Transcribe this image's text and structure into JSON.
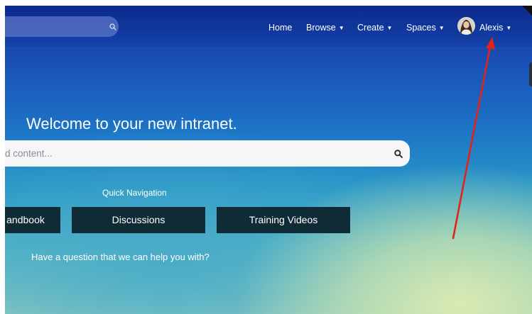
{
  "nav": {
    "home": "Home",
    "browse": "Browse",
    "create": "Create",
    "spaces": "Spaces",
    "user": "Alexis",
    "caret": "▼"
  },
  "hero": {
    "welcome": "Welcome to your new intranet.",
    "search_placeholder": "d content..."
  },
  "quick_nav": {
    "title": "Quick Navigation",
    "buttons": [
      "andbook",
      "Discussions",
      "Training Videos"
    ]
  },
  "question": "Have a question that we can help you with?",
  "icons": {
    "nav_search": "search-icon",
    "main_search": "search-icon",
    "annotation": "red-arrow-icon"
  },
  "colors": {
    "annotation_arrow": "#e0241b",
    "button_bg": "#0f2b36",
    "search_bg": "#f5f6f8"
  }
}
